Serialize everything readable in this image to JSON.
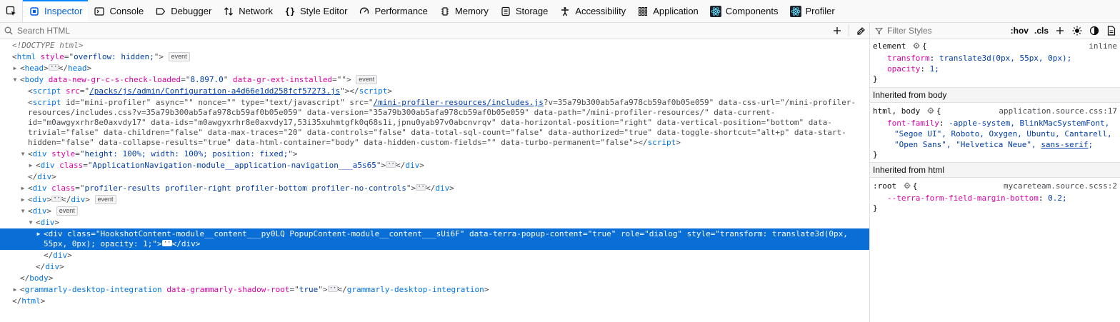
{
  "tabs": [
    {
      "label": "Inspector",
      "icon": "inspector-icon",
      "active": true
    },
    {
      "label": "Console",
      "icon": "console-icon"
    },
    {
      "label": "Debugger",
      "icon": "debugger-icon"
    },
    {
      "label": "Network",
      "icon": "network-icon"
    },
    {
      "label": "Style Editor",
      "icon": "style-editor-icon"
    },
    {
      "label": "Performance",
      "icon": "performance-icon"
    },
    {
      "label": "Memory",
      "icon": "memory-icon"
    },
    {
      "label": "Storage",
      "icon": "storage-icon"
    },
    {
      "label": "Accessibility",
      "icon": "accessibility-icon"
    },
    {
      "label": "Application",
      "icon": "application-icon"
    },
    {
      "label": "Components",
      "icon": "react-icon"
    },
    {
      "label": "Profiler",
      "icon": "react-icon"
    }
  ],
  "markup_search": {
    "placeholder": "Search HTML"
  },
  "rules_filter": {
    "placeholder": "Filter Styles",
    "hov": ":hov",
    "cls": ".cls"
  },
  "markup": {
    "doctype": "<!DOCTYPE html>",
    "html_open_attr": "style",
    "html_open_val": "overflow: hidden;",
    "badge_event": "event",
    "head": "head",
    "body_attr1": "data-new-gr-c-s-check-loaded",
    "body_val1": "8.897.0",
    "body_attr2": "data-gr-ext-installed",
    "body_val2": "",
    "script1_src_attr": "src",
    "script1_src_val": "/packs/js/admin/Configuration-a4d66e1dd258fcf57273.js",
    "script2_line1": " id=\"mini-profiler\" async=\"\" nonce=\"\" type=\"text/javascript\" src=\"",
    "script2_src": "/mini-profiler-resources/includes.js",
    "script2_line1_end": "?v=35a79b300ab5afa978cb59af0b05e059\" data-css-url=\"/mini-profiler-",
    "script2_line2": "resources/includes.css?v=35a79b300ab5afa978cb59af0b05e059\" data-version=\"35a79b300ab5afa978cb59af0b05e059\" data-path=\"/mini-profiler-resources/\" data-current-",
    "script2_line3": "id=\"m0awgyxrhr8e0axvdy17\" data-ids=\"m0awgyxrhr8e0axvdy17,53i35xuhmtgfk0q68s1i,jpnu0yab97v0abcnvrqv\" data-horizontal-position=\"right\" data-vertical-position=\"bottom\" data-",
    "script2_line4": "trivial=\"false\" data-children=\"false\" data-max-traces=\"20\" data-controls=\"false\" data-total-sql-count=\"false\" data-authorized=\"true\" data-toggle-shortcut=\"alt+p\" data-start-",
    "script2_line5": "hidden=\"false\" data-collapse-results=\"true\" data-html-container=\"body\" data-hidden-custom-fields=\"\" data-turbo-permanent=\"false\">",
    "div_fixed_style": "height: 100%; width: 100%; position: fixed;",
    "appnav_class": "ApplicationNavigation-module__application-navigation___a5s65",
    "profiler_class": "profiler-results profiler-right profiler-bottom profiler-no-controls",
    "selected_line1": "class=\"HookshotContent-module__content___py0LQ PopupContent-module__content___sUi6F\" data-terra-popup-content=\"true\" role=\"dialog\" style=\"transform: translate3d(0px,",
    "selected_line2": "55px, 0px); opacity: 1;\">",
    "grammarly_tag": "grammarly-desktop-integration",
    "grammarly_attr": "data-grammarly-shadow-root",
    "grammarly_val": "true"
  },
  "rules": {
    "element": {
      "selector": "element",
      "source": "inline",
      "props": [
        {
          "name": "transform",
          "value": "translate3d(0px, 55px, 0px);"
        },
        {
          "name": "opacity",
          "value": "1;"
        }
      ]
    },
    "inherited_body": "Inherited from body",
    "body_rule": {
      "selector": "html, body",
      "source": "application.source.css:17",
      "prop_name": "font-family",
      "value_line1": "-apple-system, BlinkMacSystemFont,",
      "value_line2": "\"Segoe UI\", Roboto, Oxygen, Ubuntu, Cantarell,",
      "value_line3": "\"Open Sans\", \"Helvetica Neue\",",
      "value_line3_underlined": "sans-serif",
      "value_line3_end": ";"
    },
    "inherited_html": "Inherited from html",
    "root_rule": {
      "selector": ":root",
      "source": "mycareteam.source.scss:2",
      "prop_name": "--terra-form-field-margin-bottom",
      "prop_value": "0.2;"
    }
  },
  "colors": {
    "accent": "#0a84ff",
    "selection": "#0a6ed7",
    "tag": "#0074e8",
    "attr": "#dd00a9",
    "value": "#003eaa"
  }
}
